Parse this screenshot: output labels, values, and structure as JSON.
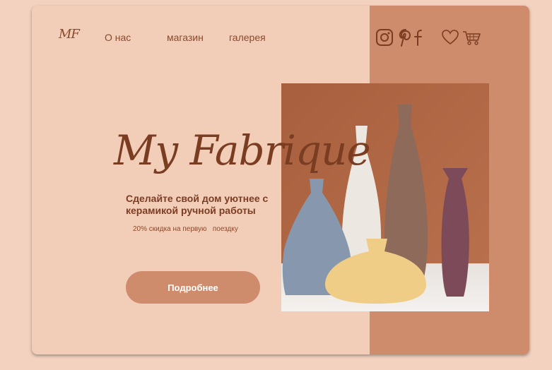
{
  "brand": {
    "logo_text": "MF"
  },
  "nav": {
    "items": [
      {
        "label": "О нас"
      },
      {
        "label": "магазин"
      },
      {
        "label": "галерея"
      }
    ]
  },
  "header_icons": [
    "instagram-icon",
    "pinterest-icon",
    "facebook-icon",
    "heart-icon",
    "cart-icon"
  ],
  "hero": {
    "title": "My Fabrique",
    "subtitle": "Сделайте свой дом уютнее с керамикой ручной работы",
    "discount": "20% скидка на первую   поездку",
    "button_label": "Подробнее"
  },
  "colors": {
    "page_bg": "#f3d2bf",
    "card_bg": "#f2cdb8",
    "accent": "#cf8c6c",
    "text_dark": "#7a3d22",
    "button_text": "#ffffff"
  }
}
